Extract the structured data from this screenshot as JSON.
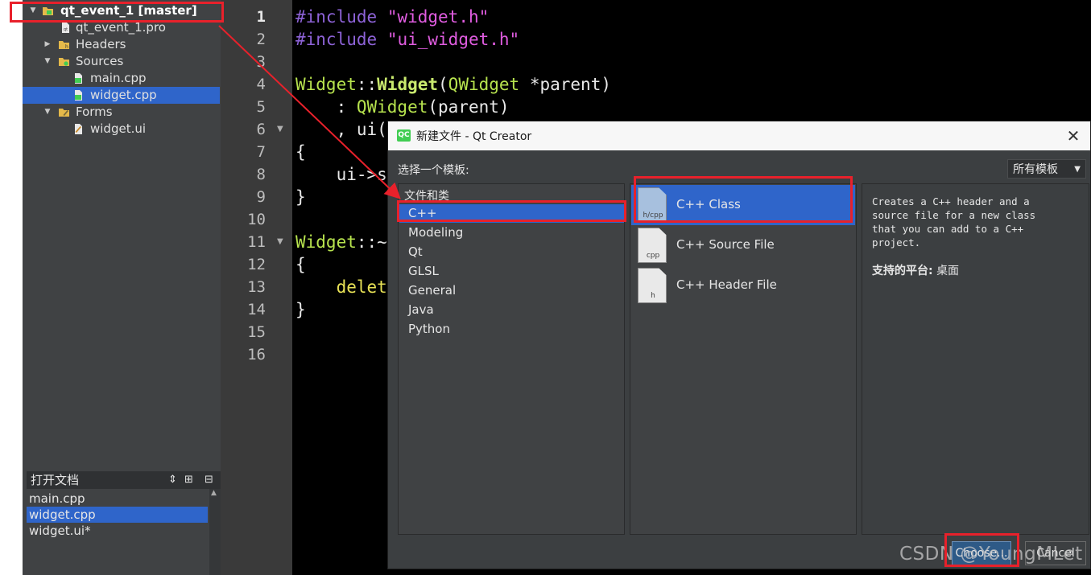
{
  "project_tree": {
    "root": "qt_event_1 [master]",
    "pro_file": "qt_event_1.pro",
    "headers": "Headers",
    "sources": "Sources",
    "source_files": [
      "main.cpp",
      "widget.cpp"
    ],
    "forms": "Forms",
    "form_files": [
      "widget.ui"
    ],
    "selected": "widget.cpp"
  },
  "open_docs": {
    "title": "打开文档",
    "items": [
      "main.cpp",
      "widget.cpp",
      "widget.ui*"
    ],
    "selected": "widget.cpp"
  },
  "editor": {
    "line_numbers": [
      "1",
      "2",
      "3",
      "4",
      "5",
      "6",
      "7",
      "8",
      "9",
      "10",
      "11",
      "12",
      "13",
      "14",
      "15",
      "16"
    ],
    "current_line": "1",
    "lines": {
      "l1": {
        "kw": "#include",
        "str": "\"widget.h\""
      },
      "l2": {
        "kw": "#include",
        "str": "\"ui_widget.h\""
      },
      "l4": {
        "cls": "Widget",
        "sep": "::",
        "fn": "Widget",
        "open": "(",
        "param_type": "QWidget",
        "param": " *parent)"
      },
      "l5": {
        "prefix": "    : ",
        "fn": "QWidget",
        "rest": "(parent)"
      },
      "l6": {
        "text": "    , ui("
      },
      "l7": {
        "text": "{"
      },
      "l8": {
        "text": "    ui->s"
      },
      "l9": {
        "text": "}"
      },
      "l11": {
        "cls": "Widget",
        "sep": "::~"
      },
      "l12": {
        "text": "{"
      },
      "l13": {
        "prefix": "    ",
        "del": "delet"
      },
      "l14": {
        "text": "}"
      }
    }
  },
  "dialog": {
    "title": "新建文件 - Qt Creator",
    "logo": "QC",
    "choose_template_label": "选择一个模板:",
    "filter_value": "所有模板",
    "category_group": "文件和类",
    "categories": [
      "C++",
      "Modeling",
      "Qt",
      "GLSL",
      "General",
      "Java",
      "Python"
    ],
    "selected_category": "C++",
    "templates": [
      {
        "label": "C++ Class",
        "icon_text": "h/cpp",
        "icon": "cpp-class-file-icon"
      },
      {
        "label": "C++ Source File",
        "icon_text": "cpp",
        "icon": "cpp-source-file-icon"
      },
      {
        "label": "C++ Header File",
        "icon_text": "h",
        "icon": "cpp-header-file-icon"
      }
    ],
    "selected_template": "C++ Class",
    "description": "Creates a C++ header and a\nsource file for a new class\nthat you can add to a C++\nproject.",
    "platform_label": "支持的平台:",
    "platform_value": "桌面",
    "choose_button": "Choose...",
    "cancel_button": "Cancel"
  },
  "watermark": "CSDN @YoungMLet",
  "colors": {
    "selection": "#2f65ca",
    "annotation_red": "#e8212b",
    "keyword": "#8e63d8",
    "string": "#e05ce0",
    "class": "#b7e34e"
  }
}
